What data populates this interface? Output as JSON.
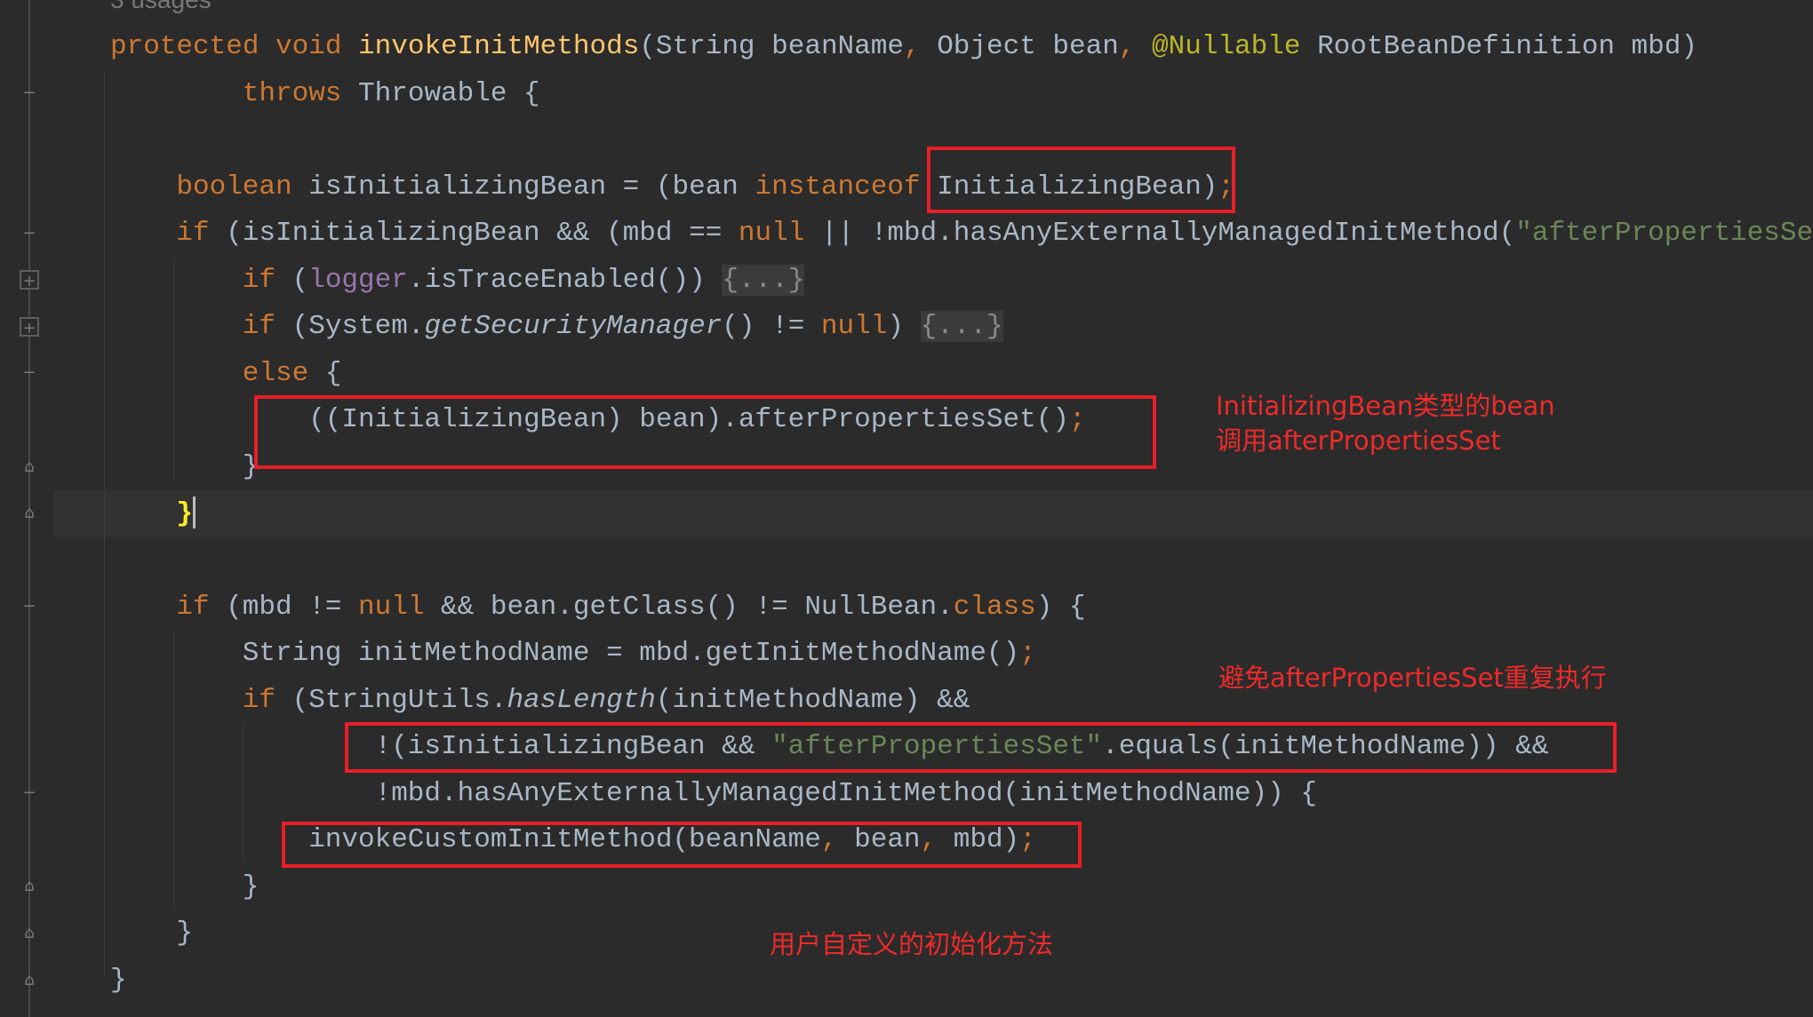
{
  "editor": {
    "usages_hint": "3 usages",
    "colors": {
      "background": "#2b2b2b",
      "keyword": "#cc7832",
      "text": "#a9b7c6",
      "method_decl": "#ffc66d",
      "string": "#6a8759",
      "annotation": "#bbb529",
      "field": "#9876aa",
      "annotation_box": "#e81f28"
    },
    "lines": [
      {
        "indent": 0,
        "tokens": [
          {
            "t": "protected void ",
            "c": "kw"
          },
          {
            "t": "invokeInitMethods",
            "c": "fn"
          },
          {
            "t": "(String beanName"
          },
          {
            "t": ", ",
            "c": "kw"
          },
          {
            "t": "Object bean"
          },
          {
            "t": ", ",
            "c": "kw"
          },
          {
            "t": "@Nullable ",
            "c": "ann"
          },
          {
            "t": "RootBeanDefinition mbd)"
          }
        ]
      },
      {
        "indent": 8,
        "tokens": [
          {
            "t": "throws ",
            "c": "kw"
          },
          {
            "t": "Throwable {"
          }
        ]
      },
      {
        "indent": 0,
        "tokens": []
      },
      {
        "indent": 4,
        "tokens": [
          {
            "t": "boolean ",
            "c": "kw"
          },
          {
            "t": "isInitializingBean = (bean "
          },
          {
            "t": "instanceof ",
            "c": "kw"
          },
          {
            "t": "InitializingBean)"
          },
          {
            "t": ";",
            "c": "kw"
          }
        ]
      },
      {
        "indent": 4,
        "tokens": [
          {
            "t": "if ",
            "c": "kw"
          },
          {
            "t": "(isInitializingBean && (mbd == "
          },
          {
            "t": "null ",
            "c": "kw"
          },
          {
            "t": "|| !mbd.hasAnyExternallyManagedInitMethod("
          },
          {
            "t": "\"afterPropertiesSet\"",
            "c": "str"
          },
          {
            "t": ")))"
          }
        ]
      },
      {
        "indent": 8,
        "tokens": [
          {
            "t": "if ",
            "c": "kw"
          },
          {
            "t": "("
          },
          {
            "t": "logger",
            "c": "field"
          },
          {
            "t": ".isTraceEnabled()) "
          },
          {
            "t": "{...}",
            "c": "fold-ph"
          }
        ]
      },
      {
        "indent": 8,
        "tokens": [
          {
            "t": "if ",
            "c": "kw"
          },
          {
            "t": "(System."
          },
          {
            "t": "getSecurityManager",
            "c": "ital"
          },
          {
            "t": "() != "
          },
          {
            "t": "null",
            "c": "kw"
          },
          {
            "t": ") "
          },
          {
            "t": "{...}",
            "c": "fold-ph"
          }
        ]
      },
      {
        "indent": 8,
        "tokens": [
          {
            "t": "else ",
            "c": "kw"
          },
          {
            "t": "{"
          }
        ]
      },
      {
        "indent": 12,
        "tokens": [
          {
            "t": "((InitializingBean) bean).afterPropertiesSet()"
          },
          {
            "t": ";",
            "c": "kw"
          }
        ]
      },
      {
        "indent": 8,
        "tokens": [
          {
            "t": "}"
          }
        ]
      },
      {
        "indent": 4,
        "tokens": [
          {
            "t": "}",
            "c": "brace-hl"
          }
        ]
      },
      {
        "indent": 0,
        "tokens": []
      },
      {
        "indent": 4,
        "tokens": [
          {
            "t": "if ",
            "c": "kw"
          },
          {
            "t": "(mbd != "
          },
          {
            "t": "null ",
            "c": "kw"
          },
          {
            "t": "&& bean.getClass() != NullBean."
          },
          {
            "t": "class",
            "c": "kw"
          },
          {
            "t": ") {"
          }
        ]
      },
      {
        "indent": 8,
        "tokens": [
          {
            "t": "String initMethodName = mbd.getInitMethodName()"
          },
          {
            "t": ";",
            "c": "kw"
          }
        ]
      },
      {
        "indent": 8,
        "tokens": [
          {
            "t": "if ",
            "c": "kw"
          },
          {
            "t": "(StringUtils."
          },
          {
            "t": "hasLength",
            "c": "ital"
          },
          {
            "t": "(initMethodName) &&"
          }
        ]
      },
      {
        "indent": 16,
        "tokens": [
          {
            "t": "!(isInitializingBean && "
          },
          {
            "t": "\"afterPropertiesSet\"",
            "c": "str"
          },
          {
            "t": ".equals(initMethodName)) &&"
          }
        ]
      },
      {
        "indent": 16,
        "tokens": [
          {
            "t": "!mbd.hasAnyExternallyManagedInitMethod(initMethodName)) {"
          }
        ]
      },
      {
        "indent": 12,
        "tokens": [
          {
            "t": "invokeCustomInitMethod(beanName"
          },
          {
            "t": ", ",
            "c": "kw"
          },
          {
            "t": "bean"
          },
          {
            "t": ", ",
            "c": "kw"
          },
          {
            "t": "mbd)"
          },
          {
            "t": ";",
            "c": "kw"
          }
        ]
      },
      {
        "indent": 8,
        "tokens": [
          {
            "t": "}"
          }
        ]
      },
      {
        "indent": 4,
        "tokens": [
          {
            "t": "}"
          }
        ]
      },
      {
        "indent": 0,
        "tokens": [
          {
            "t": "}"
          }
        ]
      }
    ]
  },
  "annotations": {
    "note1_line1": "InitializingBean类型的bean",
    "note1_line2": "调用afterPropertiesSet",
    "note2": "避免afterPropertiesSet重复执行",
    "note3": "用户自定义的初始化方法"
  }
}
